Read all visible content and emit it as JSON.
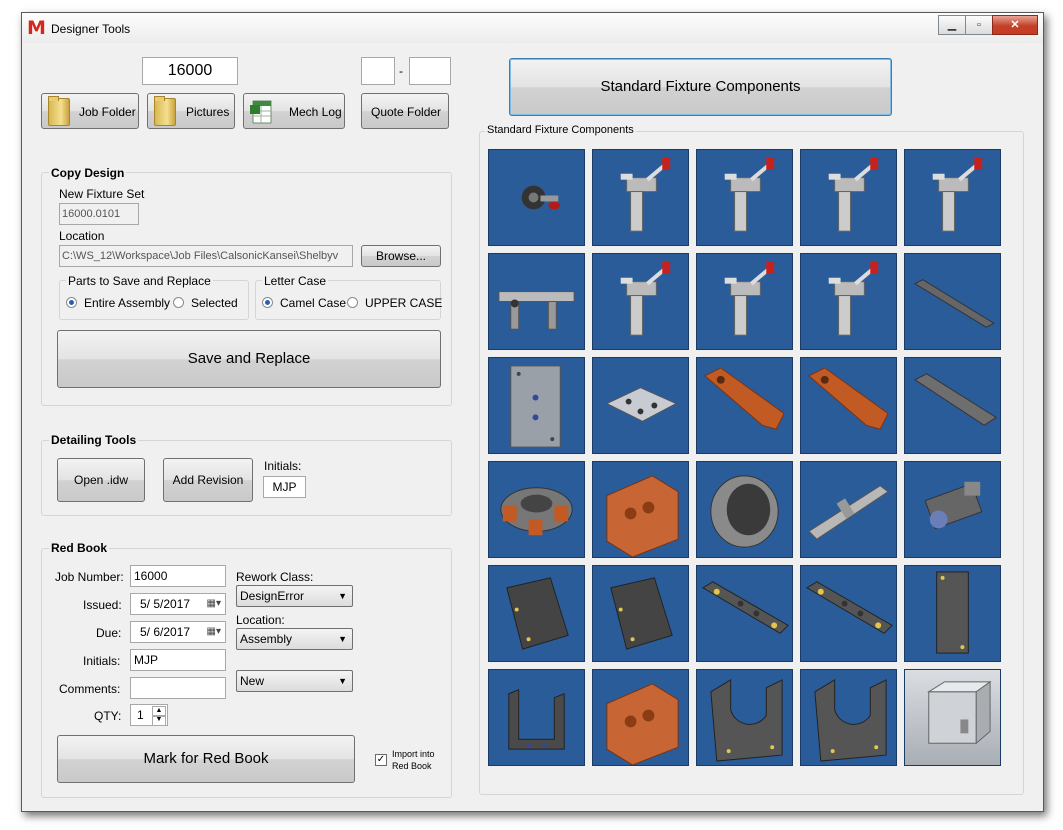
{
  "app": {
    "logo": "M",
    "title": "Designer Tools"
  },
  "window_controls": {
    "minimize": "▁",
    "maximize": "▫",
    "close": "✕"
  },
  "top": {
    "job_number": "16000",
    "range_dash": "-",
    "range_from": "",
    "range_to": "",
    "job_folder": "Job Folder",
    "pictures": "Pictures",
    "mech_log": "Mech Log",
    "quote_folder": "Quote Folder"
  },
  "copy_design": {
    "title": "Copy Design",
    "new_fixture_label": "New Fixture Set",
    "new_fixture_value": "16000.0101",
    "location_label": "Location",
    "location_value": "C:\\WS_12\\Workspace\\Job Files\\CalsonicKansei\\Shelbyv",
    "browse": "Browse...",
    "parts_title": "Parts to Save and Replace",
    "entire_assembly": "Entire Assembly",
    "selected": "Selected",
    "letter_case_title": "Letter Case",
    "camel_case": "Camel Case",
    "upper_case": "UPPER CASE",
    "save_replace": "Save and Replace"
  },
  "detailing": {
    "title": "Detailing Tools",
    "open_idw": "Open .idw",
    "add_revision": "Add Revision",
    "initials_label": "Initials:",
    "initials_value": "MJP"
  },
  "red_book": {
    "title": "Red Book",
    "job_number_label": "Job Number:",
    "job_number_value": "16000",
    "issued_label": "Issued:",
    "issued_value": "5/ 5/2017",
    "due_label": "Due:",
    "due_value": "5/ 6/2017",
    "initials_label": "Initials:",
    "initials_value": "MJP",
    "comments_label": "Comments:",
    "comments_value": "",
    "qty_label": "QTY:",
    "qty_value": "1",
    "rework_class_label": "Rework Class:",
    "rework_class_value": "DesignError",
    "location_label": "Location:",
    "location_value": "Assembly",
    "status_value": "New",
    "mark_button": "Mark for Red Book",
    "import_label_1": "Import into",
    "import_label_2": "Red Book",
    "import_checked": true
  },
  "library": {
    "button": "Standard Fixture Components",
    "group_title": "Standard Fixture Components",
    "tile_bg": "#2b5c9a",
    "items": [
      "knob-icon",
      "toggle-clamp-icon",
      "toggle-clamp-icon",
      "toggle-clamp-icon",
      "toggle-clamp-icon",
      "slide-clamp-icon",
      "toggle-clamp-icon",
      "toggle-clamp-icon",
      "toggle-clamp-icon",
      "rail-bar-icon",
      "mounting-plate-icon",
      "locator-plate-icon",
      "copper-arm-icon",
      "copper-arm-icon",
      "steel-bar-icon",
      "rotary-index-icon",
      "copper-block-icon",
      "bushing-icon",
      "shaft-icon",
      "actuator-icon",
      "steel-plate-icon",
      "steel-plate-icon",
      "hole-bar-icon",
      "hole-bar-icon",
      "flat-plate-icon",
      "u-bracket-icon",
      "copper-block-icon",
      "cradle-icon",
      "cradle-icon",
      "enclosure-box-icon"
    ]
  }
}
